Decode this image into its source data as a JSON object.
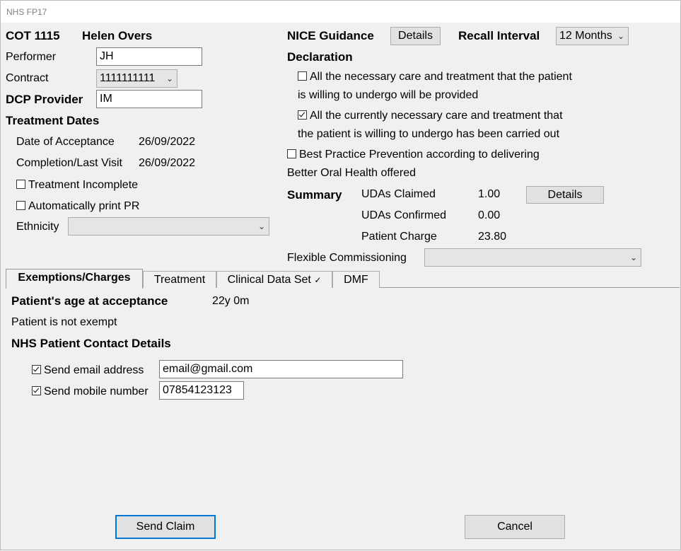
{
  "window": {
    "title": "NHS FP17"
  },
  "header": {
    "cot": "COT 1115",
    "patient_name": "Helen Overs"
  },
  "performer": {
    "label": "Performer",
    "value": "JH"
  },
  "contract": {
    "label": "Contract",
    "value": "1111111111"
  },
  "dcp": {
    "label": "DCP Provider",
    "value": "IM"
  },
  "treatment_dates": {
    "heading": "Treatment Dates",
    "acceptance_label": "Date of Acceptance",
    "acceptance_value": "26/09/2022",
    "completion_label": "Completion/Last Visit",
    "completion_value": "26/09/2022"
  },
  "treatment_incomplete": {
    "label": "Treatment Incomplete",
    "checked": false
  },
  "auto_print": {
    "label": "Automatically print PR",
    "checked": false
  },
  "ethnicity": {
    "label": "Ethnicity",
    "value": ""
  },
  "nice": {
    "label": "NICE Guidance",
    "button": "Details"
  },
  "recall": {
    "label": "Recall Interval",
    "value": "12 Months"
  },
  "declaration": {
    "heading": "Declaration",
    "item1_line1": "All the necessary care and treatment that the patient",
    "item1_line2": "is willing to undergo will be provided",
    "item1_checked": false,
    "item2_line1": "All the currently necessary care and treatment that",
    "item2_line2": "the patient is willing to undergo has been carried out",
    "item2_checked": true,
    "item3_line1": "Best Practice Prevention according to delivering",
    "item3_line2": "Better Oral Health offered",
    "item3_checked": false
  },
  "summary": {
    "heading": "Summary",
    "udas_claimed_label": "UDAs Claimed",
    "udas_claimed_value": "1.00",
    "udas_confirmed_label": "UDAs Confirmed",
    "udas_confirmed_value": "0.00",
    "charge_label": "Patient Charge",
    "charge_value": "23.80",
    "details_button": "Details"
  },
  "flexible": {
    "label": "Flexible Commissioning",
    "value": ""
  },
  "tabs": [
    {
      "label": "Exemptions/Charges",
      "active": true
    },
    {
      "label": "Treatment",
      "active": false
    },
    {
      "label": "Clinical Data Set",
      "active": false
    },
    {
      "label": "DMF",
      "active": false
    }
  ],
  "exemptions": {
    "age_label": "Patient's age at acceptance",
    "age_value": "22y 0m",
    "exempt_status": "Patient is not exempt",
    "contact_heading": "NHS Patient Contact Details",
    "email_label": "Send email address",
    "email_checked": true,
    "email_value": "email@gmail.com",
    "mobile_label": "Send mobile number",
    "mobile_checked": true,
    "mobile_value": "07854123123"
  },
  "footer": {
    "send_button": "Send Claim",
    "cancel_button": "Cancel"
  }
}
